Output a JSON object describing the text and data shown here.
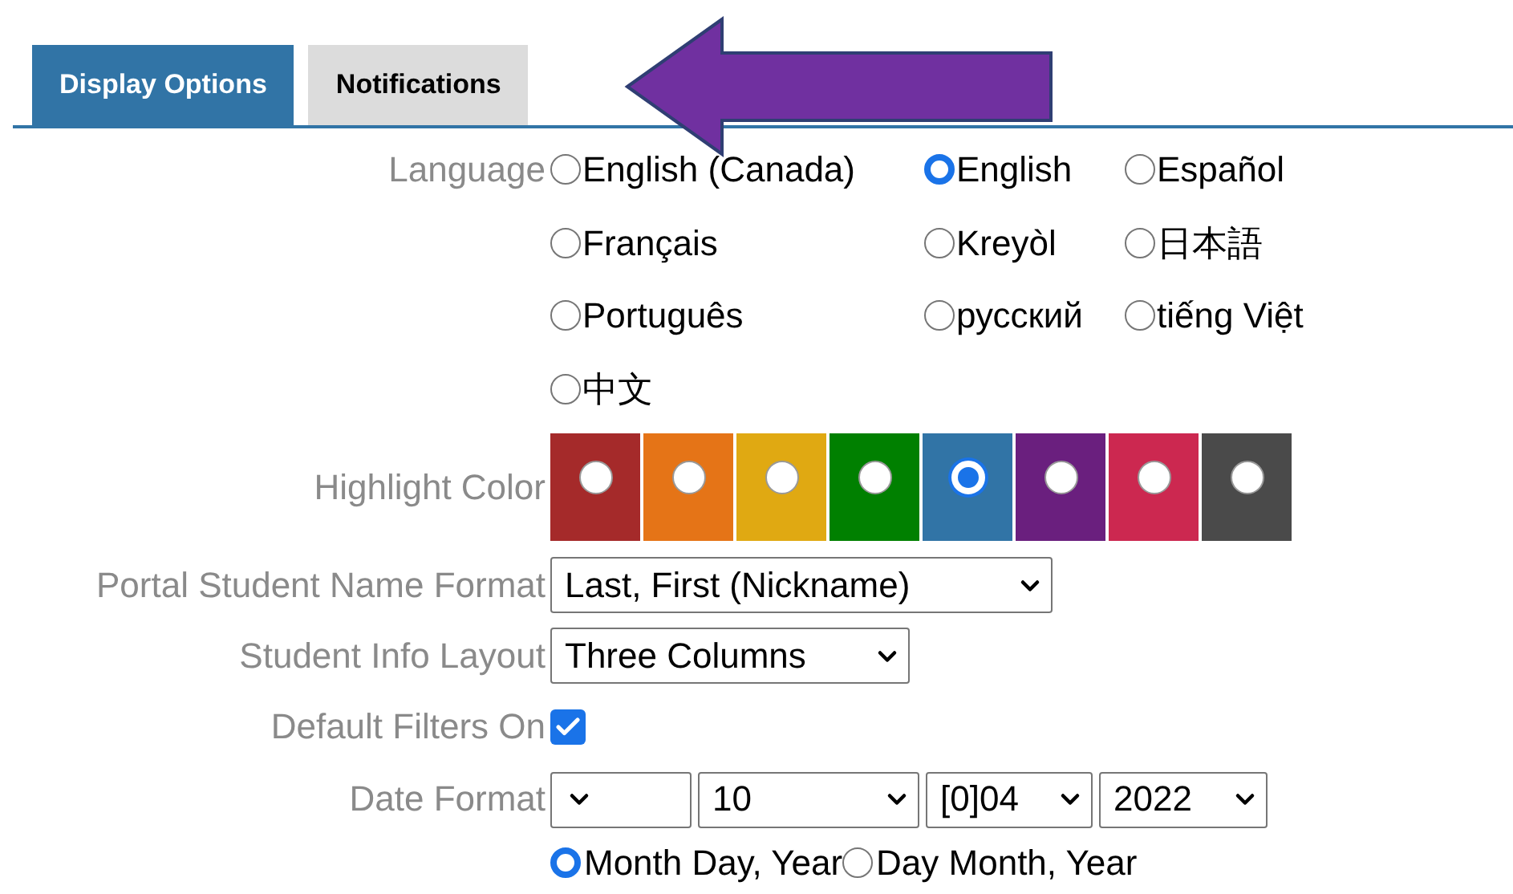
{
  "tabs": [
    {
      "label": "Display Options",
      "selected": true
    },
    {
      "label": "Notifications",
      "selected": false
    }
  ],
  "language": {
    "label": "Language",
    "options": [
      {
        "label": "English (Canada)",
        "selected": false
      },
      {
        "label": "English",
        "selected": true
      },
      {
        "label": "Español",
        "selected": false
      },
      {
        "label": "Français",
        "selected": false
      },
      {
        "label": "Kreyòl",
        "selected": false
      },
      {
        "label": "日本語",
        "selected": false
      },
      {
        "label": "Português",
        "selected": false
      },
      {
        "label": "русский",
        "selected": false
      },
      {
        "label": "tiếng Việt",
        "selected": false
      },
      {
        "label": "中文",
        "selected": false
      }
    ]
  },
  "highlight_color": {
    "label": "Highlight Color",
    "swatches": [
      {
        "color": "#a52a2a",
        "selected": false
      },
      {
        "color": "#e57417",
        "selected": false
      },
      {
        "color": "#e0a912",
        "selected": false
      },
      {
        "color": "#008000",
        "selected": false
      },
      {
        "color": "#3174a6",
        "selected": true
      },
      {
        "color": "#6a1f7e",
        "selected": false
      },
      {
        "color": "#cc2850",
        "selected": false
      },
      {
        "color": "#4a4a4a",
        "selected": false
      }
    ]
  },
  "name_format": {
    "label": "Portal Student Name Format",
    "value": "Last, First (Nickname)"
  },
  "info_layout": {
    "label": "Student Info Layout",
    "value": "Three Columns"
  },
  "default_filters": {
    "label": "Default Filters On",
    "checked": true
  },
  "date_format": {
    "label": "Date Format",
    "selects": [
      {
        "kind": "blank"
      },
      {
        "kind": "filled",
        "value": "10"
      },
      {
        "kind": "filled",
        "value": "[0]04"
      },
      {
        "kind": "filled",
        "value": "2022"
      }
    ],
    "order_options": [
      {
        "label": "Month Day, Year",
        "selected": true
      },
      {
        "label": "Day Month, Year",
        "selected": false
      }
    ]
  }
}
